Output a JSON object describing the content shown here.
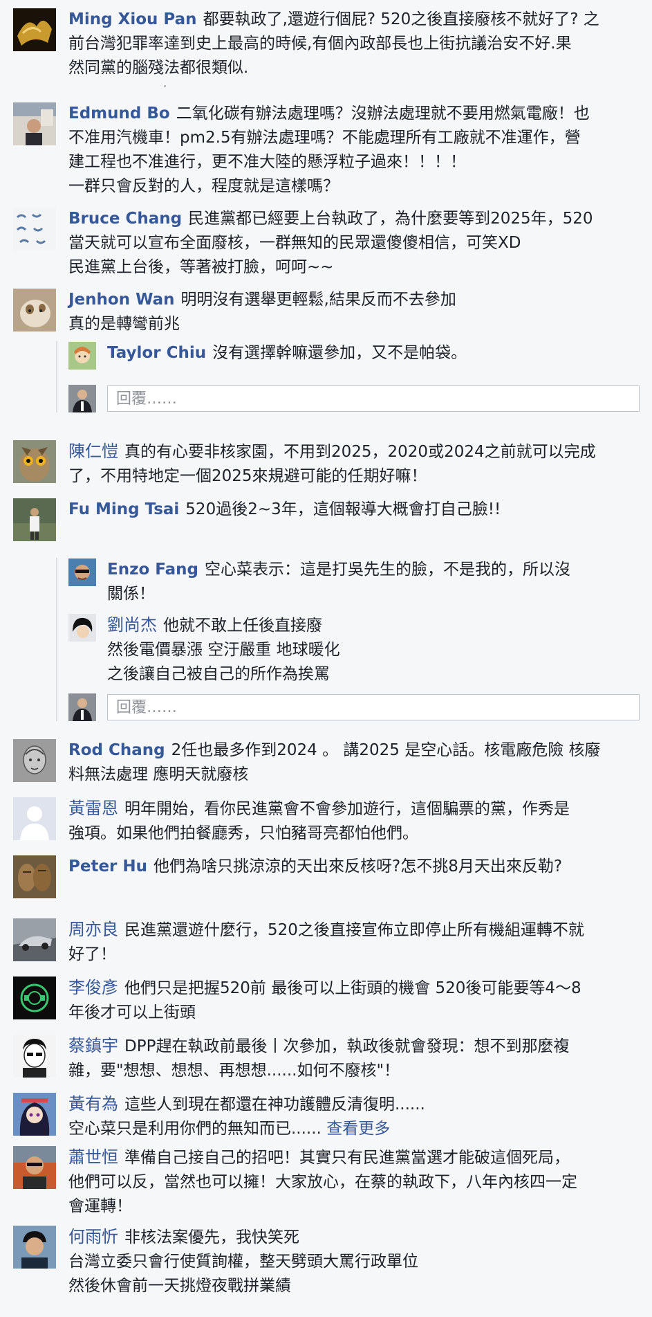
{
  "comments": [
    {
      "name": "Ming Xiou Pan",
      "lines": [
        "都要執政了,還遊行個屁? 520之後直接廢核不就好了? 之",
        "前台灣犯罪率達到史上最高的時候,有個內政部長也上街抗議治安不好.果",
        "然同黨的腦殘法都很類似."
      ]
    },
    {
      "name": "Edmund Bo",
      "lines": [
        "二氧化碳有辦法處理嗎？沒辦法處理就不要用燃氣電廠！也",
        "不准用汽機車！pm2.5有辦法處理嗎？不能處理所有工廠就不准運作，營",
        "建工程也不准進行，更不准大陸的懸浮粒子過來！！！！",
        "一群只會反對的人，程度就是這樣嗎？"
      ]
    },
    {
      "name": "Bruce Chang",
      "lines": [
        "民進黨都已經要上台執政了，為什麼要等到2025年，520",
        "當天就可以宣布全面廢核，一群無知的民眾還傻傻相信，可笑XD",
        "民進黨上台後，等著被打臉，呵呵~~"
      ]
    },
    {
      "name": "Jenhon Wan",
      "lines": [
        "明明沒有選舉更輕鬆,結果反而不去參加",
        "真的是轉彎前兆"
      ]
    },
    {
      "name": "Taylor Chiu",
      "lines": [
        "沒有選擇幹嘛還參加，又不是帕袋。"
      ]
    },
    {
      "name": "陳仁愷",
      "lines": [
        "真的有心要非核家園，不用到2025，2020或2024之前就可以完成",
        "了，不用特地定一個2025來規避可能的任期好嘛！"
      ]
    },
    {
      "name": "Fu Ming Tsai",
      "lines": [
        "520過後2~3年，這個報導大概會打自己臉!!"
      ]
    },
    {
      "name": "Enzo Fang",
      "lines": [
        "空心菜表示：這是打吳先生的臉，不是我的，所以沒",
        "關係！"
      ]
    },
    {
      "name": "劉尚杰",
      "lines": [
        "他就不敢上任後直接廢",
        "然後電價暴漲 空汙嚴重 地球暖化",
        "之後讓自己被自己的所作為挨罵"
      ]
    },
    {
      "name": "Rod Chang",
      "lines": [
        "2任也最多作到2024 。 講2025 是空心話。核電廠危險 核廢",
        "料無法處理 應明天就廢核"
      ]
    },
    {
      "name": "黃雷恩",
      "lines": [
        "明年開始，看你民進黨會不會參加遊行，這個騙票的黨，作秀是",
        "強項。如果他們拍餐廳秀，只怕豬哥亮都怕他們。"
      ]
    },
    {
      "name": "Peter Hu",
      "lines": [
        "他們為啥只挑涼涼的天出來反核呀?怎不挑8月天出來反勒?"
      ]
    },
    {
      "name": "周亦良",
      "lines": [
        "民進黨還遊什麼行，520之後直接宣佈立即停止所有機組運轉不就",
        "好了！"
      ]
    },
    {
      "name": "李俊彥",
      "lines": [
        "他們只是把握520前 最後可以上街頭的機會 520後可能要等4～8",
        "年後才可以上街頭"
      ]
    },
    {
      "name": "蔡鎮宇",
      "lines": [
        "DPP趕在執政前最後丨次參加，執政後就會發現：想不到那麼複",
        "雜，要\"想想、想想、再想想......如何不廢核\"！"
      ]
    },
    {
      "name": "黃有為",
      "lines": [
        "這些人到現在都還在神功護體反清復明......",
        "空心菜只是利用你們的無知而已......"
      ],
      "see_more": "查看更多"
    },
    {
      "name": "蕭世恒",
      "lines": [
        "準備自己接自己的招吧！其實只有民進黨當選才能破這個死局，",
        "他們可以反，當然也可以擁！大家放心，在蔡的執政下，八年內核四一定",
        "會運轉！"
      ]
    },
    {
      "name": "何雨忻",
      "lines": [
        "非核法案優先，我快笑死",
        "台灣立委只會行使質詢權，整天劈頭大罵行政單位",
        "然後休會前一天挑燈夜戰拼業績"
      ]
    }
  ],
  "reply_placeholder": "回覆……",
  "colors": {
    "name_link": "#365899",
    "body_text": "#1d2129",
    "background": "#f6f7f9"
  }
}
